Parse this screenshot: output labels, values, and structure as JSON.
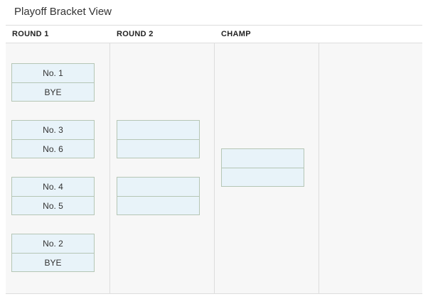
{
  "page": {
    "title": "Playoff Bracket View"
  },
  "columns": [
    {
      "label": "ROUND 1"
    },
    {
      "label": "ROUND 2"
    },
    {
      "label": "CHAMP"
    },
    {
      "label": ""
    }
  ],
  "rounds": {
    "round1": [
      {
        "top": "No. 1",
        "bottom": "BYE"
      },
      {
        "top": "No. 3",
        "bottom": "No. 6"
      },
      {
        "top": "No. 4",
        "bottom": "No. 5"
      },
      {
        "top": "No. 2",
        "bottom": "BYE"
      }
    ],
    "round2": [
      {
        "top": "",
        "bottom": ""
      },
      {
        "top": "",
        "bottom": ""
      }
    ],
    "champ": [
      {
        "top": "",
        "bottom": ""
      }
    ]
  },
  "colors": {
    "slot_fill": "#e8f3f9",
    "slot_border": "#b5c6b5",
    "background": "#f7f7f7"
  }
}
